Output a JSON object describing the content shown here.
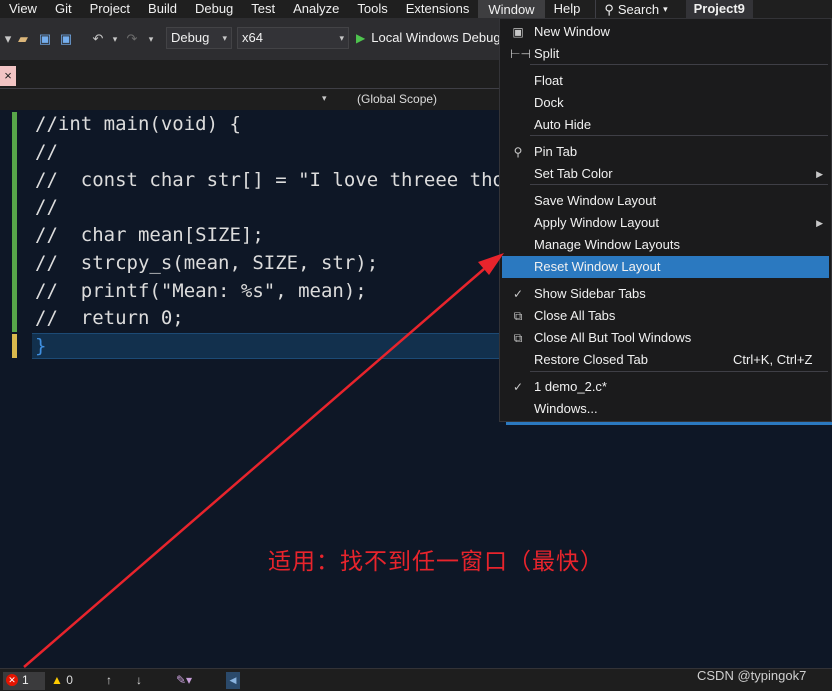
{
  "menubar": {
    "items": [
      "View",
      "Git",
      "Project",
      "Build",
      "Debug",
      "Test",
      "Analyze",
      "Tools",
      "Extensions",
      "Window",
      "Help"
    ],
    "search_label": "Search",
    "project_title": "Project9"
  },
  "toolbar": {
    "configuration": "Debug",
    "platform": "x64",
    "run_label": "Local Windows Debugger"
  },
  "tab": {
    "close_glyph": "×"
  },
  "navbar": {
    "scope": "(Global Scope)"
  },
  "editor": {
    "lines": [
      "//int main(void) {",
      "//",
      "//  const char str[] = \"I love threee thousand\";",
      "//",
      "//  char mean[SIZE];",
      "//  strcpy_s(mean, SIZE, str);",
      "//  printf(\"Mean: %s\", mean);",
      "//  return 0;",
      "}"
    ]
  },
  "window_menu": {
    "items": [
      {
        "label": "New Window",
        "icon": "new-window-icon",
        "glyph": "▣"
      },
      {
        "label": "Split",
        "icon": "split-icon",
        "glyph": "⊢⊣"
      },
      {
        "label": "Float"
      },
      {
        "label": "Dock"
      },
      {
        "label": "Auto Hide"
      },
      {
        "label": "Pin Tab",
        "icon": "pin-icon",
        "glyph": "⚲"
      },
      {
        "label": "Set Tab Color",
        "submenu": true
      },
      {
        "label": "Save Window Layout"
      },
      {
        "label": "Apply Window Layout",
        "submenu": true
      },
      {
        "label": "Manage Window Layouts"
      },
      {
        "label": "Reset Window Layout",
        "highlighted": true
      },
      {
        "label": "Show Sidebar Tabs",
        "checked": true
      },
      {
        "label": "Close All Tabs",
        "icon": "close-all-tabs-icon",
        "glyph": "⧉"
      },
      {
        "label": "Close All But Tool Windows",
        "icon": "close-all-but-tool-windows-icon",
        "glyph": "⧉"
      },
      {
        "label": "Restore Closed Tab",
        "shortcut": "Ctrl+K, Ctrl+Z"
      },
      {
        "label": "1 demo_2.c*",
        "checked": true
      },
      {
        "label": "Windows..."
      }
    ],
    "check_glyph": "✓",
    "submenu_glyph": "▶"
  },
  "annotation": {
    "text": "适用：找不到任一窗口（最快）"
  },
  "statusbar": {
    "errors": "1",
    "warnings": "0"
  },
  "watermark": "CSDN @typingok7",
  "colors": {
    "highlight": "#2b79c0",
    "annotation": "#e8242c",
    "editor_bg": "#0e1726"
  }
}
